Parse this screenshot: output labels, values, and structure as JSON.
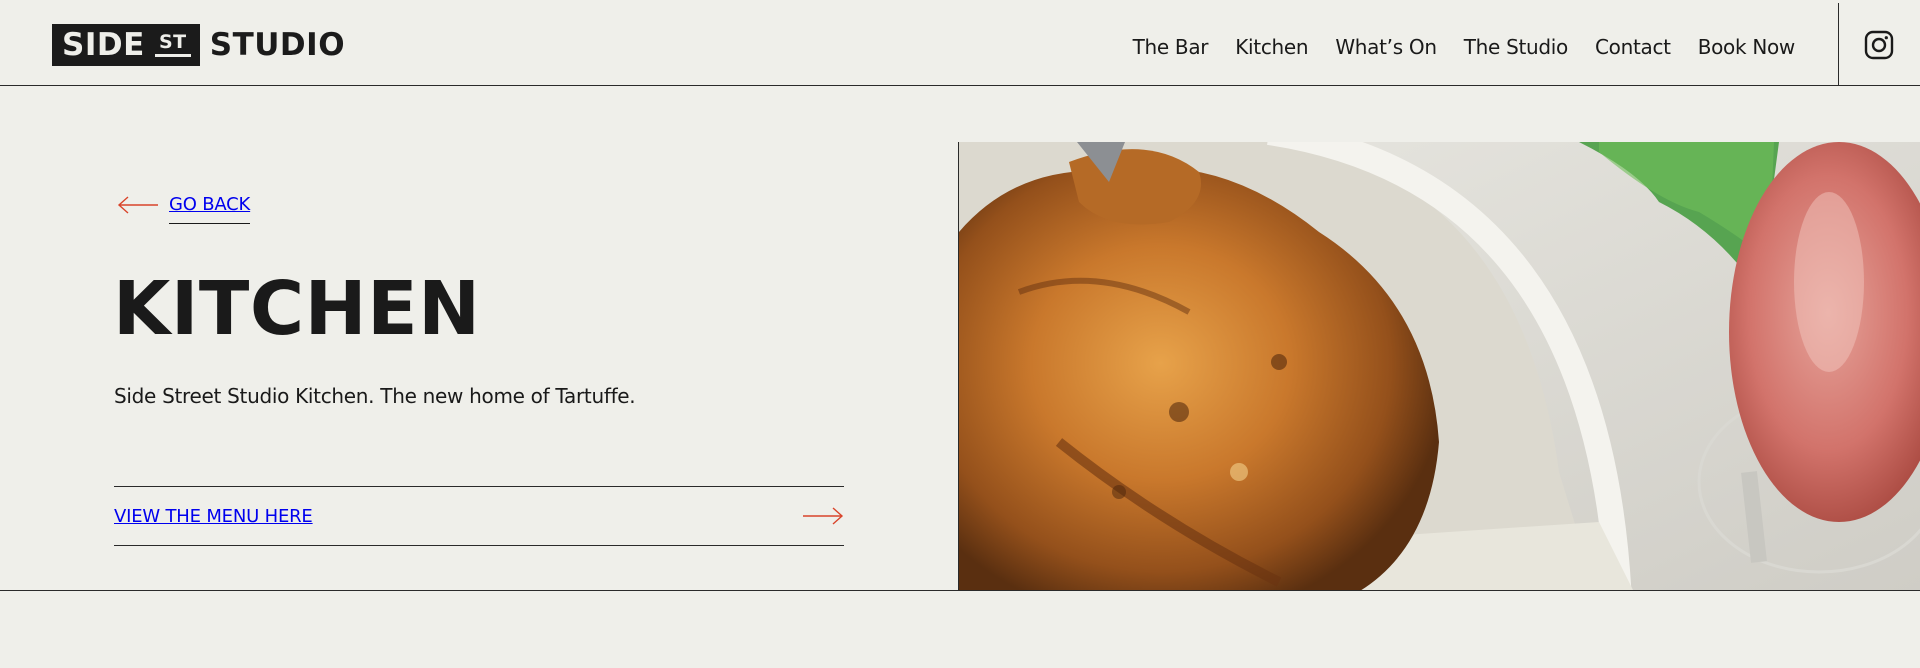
{
  "header": {
    "logo": {
      "box_text": "SIDE",
      "st_text": "ST",
      "word": "STUDIO"
    },
    "nav": [
      {
        "label": "The Bar"
      },
      {
        "label": "Kitchen"
      },
      {
        "label": "What’s On"
      },
      {
        "label": "The Studio"
      },
      {
        "label": "Contact"
      },
      {
        "label": "Book Now"
      }
    ],
    "social_icon": "instagram-icon"
  },
  "main": {
    "go_back_label": "GO BACK",
    "title": "KITCHEN",
    "subtitle": "Side Street Studio Kitchen. The new home of Tartuffe.",
    "menu_link_label": "VIEW THE MENU HERE",
    "hero_image": "roast-chicken-and-wine-photo"
  },
  "colors": {
    "background": "#efefea",
    "text": "#1a1a1a",
    "accent_arrow": "#d9442a"
  }
}
